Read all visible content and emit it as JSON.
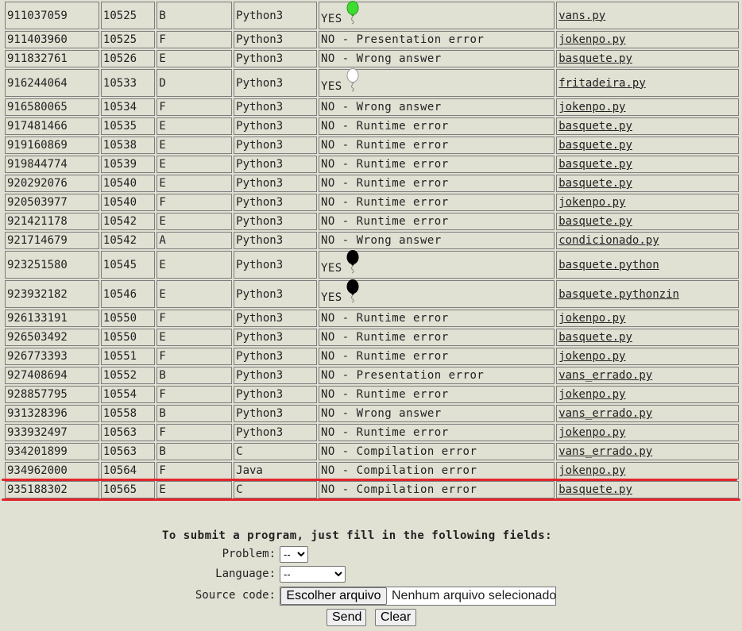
{
  "runs": [
    {
      "id": "911037059",
      "time": "10525",
      "problem": "B",
      "lang": "Python3",
      "verdict": "YES",
      "balloon": "#3fdc2f",
      "file": "vans.py"
    },
    {
      "id": "911403960",
      "time": "10525",
      "problem": "F",
      "lang": "Python3",
      "verdict": "NO - Presentation error",
      "file": "jokenpo.py"
    },
    {
      "id": "911832761",
      "time": "10526",
      "problem": "E",
      "lang": "Python3",
      "verdict": "NO - Wrong answer",
      "file": "basquete.py"
    },
    {
      "id": "916244064",
      "time": "10533",
      "problem": "D",
      "lang": "Python3",
      "verdict": "YES",
      "balloon": "#ffffff",
      "file": "fritadeira.py"
    },
    {
      "id": "916580065",
      "time": "10534",
      "problem": "F",
      "lang": "Python3",
      "verdict": "NO - Wrong answer",
      "file": "jokenpo.py"
    },
    {
      "id": "917481466",
      "time": "10535",
      "problem": "E",
      "lang": "Python3",
      "verdict": "NO - Runtime error",
      "file": "basquete.py"
    },
    {
      "id": "919160869",
      "time": "10538",
      "problem": "E",
      "lang": "Python3",
      "verdict": "NO - Runtime error",
      "file": "basquete.py"
    },
    {
      "id": "919844774",
      "time": "10539",
      "problem": "E",
      "lang": "Python3",
      "verdict": "NO - Runtime error",
      "file": "basquete.py"
    },
    {
      "id": "920292076",
      "time": "10540",
      "problem": "E",
      "lang": "Python3",
      "verdict": "NO - Runtime error",
      "file": "basquete.py"
    },
    {
      "id": "920503977",
      "time": "10540",
      "problem": "F",
      "lang": "Python3",
      "verdict": "NO - Runtime error",
      "file": "jokenpo.py"
    },
    {
      "id": "921421178",
      "time": "10542",
      "problem": "E",
      "lang": "Python3",
      "verdict": "NO - Runtime error",
      "file": "basquete.py"
    },
    {
      "id": "921714679",
      "time": "10542",
      "problem": "A",
      "lang": "Python3",
      "verdict": "NO - Wrong answer",
      "file": "condicionado.py"
    },
    {
      "id": "923251580",
      "time": "10545",
      "problem": "E",
      "lang": "Python3",
      "verdict": "YES",
      "balloon": "#000000",
      "file": "basquete.python"
    },
    {
      "id": "923932182",
      "time": "10546",
      "problem": "E",
      "lang": "Python3",
      "verdict": "YES",
      "balloon": "#000000",
      "file": "basquete.pythonzin"
    },
    {
      "id": "926133191",
      "time": "10550",
      "problem": "F",
      "lang": "Python3",
      "verdict": "NO - Runtime error",
      "file": "jokenpo.py"
    },
    {
      "id": "926503492",
      "time": "10550",
      "problem": "E",
      "lang": "Python3",
      "verdict": "NO - Runtime error",
      "file": "basquete.py"
    },
    {
      "id": "926773393",
      "time": "10551",
      "problem": "F",
      "lang": "Python3",
      "verdict": "NO - Runtime error",
      "file": "jokenpo.py"
    },
    {
      "id": "927408694",
      "time": "10552",
      "problem": "B",
      "lang": "Python3",
      "verdict": "NO - Presentation error",
      "file": "vans_errado.py"
    },
    {
      "id": "928857795",
      "time": "10554",
      "problem": "F",
      "lang": "Python3",
      "verdict": "NO - Runtime error",
      "file": "jokenpo.py"
    },
    {
      "id": "931328396",
      "time": "10558",
      "problem": "B",
      "lang": "Python3",
      "verdict": "NO - Wrong answer",
      "file": "vans_errado.py"
    },
    {
      "id": "933932497",
      "time": "10563",
      "problem": "F",
      "lang": "Python3",
      "verdict": "NO - Runtime error",
      "file": "jokenpo.py"
    },
    {
      "id": "934201899",
      "time": "10563",
      "problem": "B",
      "lang": "C",
      "verdict": "NO - Compilation error",
      "file": "vans_errado.py"
    },
    {
      "id": "934962000",
      "time": "10564",
      "problem": "F",
      "lang": "Java",
      "verdict": "NO - Compilation error",
      "file": "jokenpo.py"
    },
    {
      "id": "935188302",
      "time": "10565",
      "problem": "E",
      "lang": "C",
      "verdict": "NO - Compilation error",
      "file": "basquete.py"
    }
  ],
  "form": {
    "title": "To submit a program, just fill in the following fields:",
    "problem_label": "Problem:",
    "problem_value": "--",
    "language_label": "Language:",
    "language_value": "--",
    "source_label": "Source code:",
    "file_button": "Escolher arquivo",
    "file_status": "Nenhum arquivo selecionado",
    "send_label": "Send",
    "clear_label": "Clear"
  },
  "colors": {
    "background": "#e0e0d3",
    "highlight": "#e3252a"
  }
}
